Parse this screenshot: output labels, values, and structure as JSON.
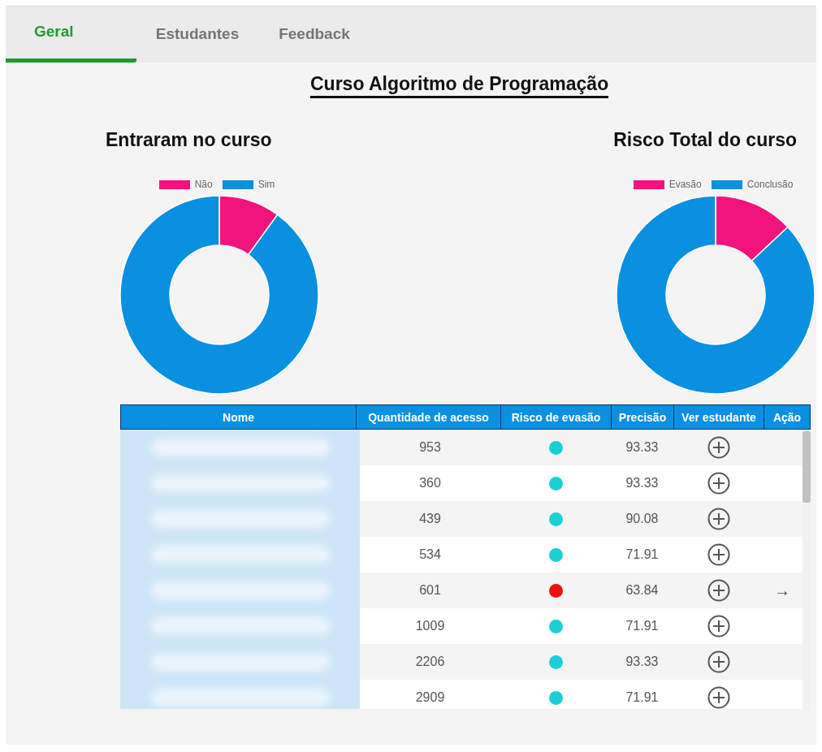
{
  "tabs": [
    {
      "label": "Geral",
      "selected": true
    },
    {
      "label": "Estudantes",
      "selected": false
    },
    {
      "label": "Feedback",
      "selected": false
    }
  ],
  "course_title": "Curso Algoritmo de Programação",
  "charts": [
    {
      "title": "Entraram no curso",
      "legend": [
        {
          "label": "Não",
          "color": "#f0147c"
        },
        {
          "label": "Sim",
          "color": "#0a90e0"
        }
      ]
    },
    {
      "title": "Risco Total do curso",
      "legend": [
        {
          "label": "Evasão",
          "color": "#f0147c"
        },
        {
          "label": "Conclusão",
          "color": "#0a90e0"
        }
      ]
    }
  ],
  "table": {
    "columns": [
      "Nome",
      "Quantidade de acesso",
      "Risco de evasão",
      "Precisão",
      "Ver estudante",
      "Ação"
    ],
    "rows": [
      {
        "accesses": "953",
        "color": "#1ccfd4",
        "precision": "93.33"
      },
      {
        "accesses": "360",
        "color": "#1ccfd4",
        "precision": "93.33"
      },
      {
        "accesses": "439",
        "color": "#1ccfd4",
        "precision": "90.08"
      },
      {
        "accesses": "534",
        "color": "#1ccfd4",
        "precision": "71.91"
      },
      {
        "accesses": "601",
        "color": "#ee1111",
        "precision": "63.84",
        "action": "→"
      },
      {
        "accesses": "1009",
        "color": "#1ccfd4",
        "precision": "71.91"
      },
      {
        "accesses": "2206",
        "color": "#1ccfd4",
        "precision": "93.33"
      },
      {
        "accesses": "2909",
        "color": "#1ccfd4",
        "precision": "71.91"
      }
    ]
  }
}
